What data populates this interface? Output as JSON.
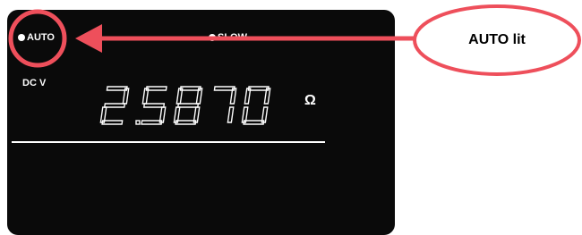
{
  "display": {
    "auto_label": "AUTO",
    "slow_label": "SLOW",
    "function_label": "DC V",
    "reading": "2.5870",
    "unit_symbol": "Ω"
  },
  "annotation": {
    "label": "AUTO lit",
    "color": "#ee4f5b"
  }
}
